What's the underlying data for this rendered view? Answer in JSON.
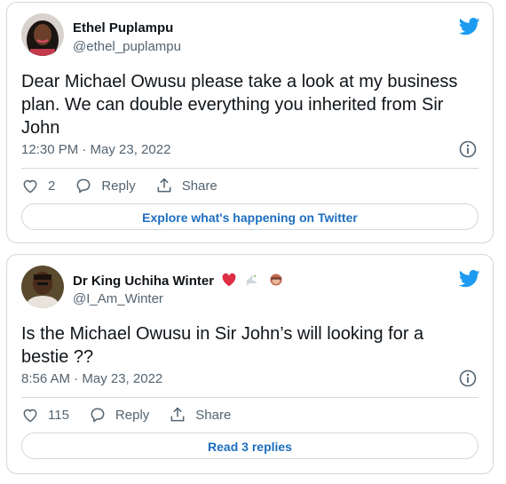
{
  "tweets": [
    {
      "name": "Ethel Puplampu",
      "handle": "@ethel_puplampu",
      "text": "Dear Michael Owusu please take a look at my business plan. We can double everything you inherited from Sir John",
      "time": "12:30 PM · May 23, 2022",
      "likes": "2",
      "reply_label": "Reply",
      "share_label": "Share",
      "bottom_button": "Explore what's happening on Twitter"
    },
    {
      "name": "Dr King Uchiha Winter",
      "handle": "@I_Am_Winter",
      "text": "Is the Michael Owusu in Sir John’s will looking for a bestie ??",
      "time": "8:56 AM · May 23, 2022",
      "likes": "115",
      "reply_label": "Reply",
      "share_label": "Share",
      "bottom_button": "Read 3 replies"
    }
  ],
  "colors": {
    "twitter_blue": "#1d9bf0",
    "link_blue": "#1d6ebe",
    "heart_red": "#e0245e",
    "gray_text": "#536471",
    "border": "#cfd9de"
  },
  "icons": [
    "twitter-bird-icon",
    "info-icon",
    "heart-icon",
    "reply-icon",
    "share-icon",
    "red-heart-emoji",
    "dove-emoji",
    "monkey-emoji"
  ]
}
